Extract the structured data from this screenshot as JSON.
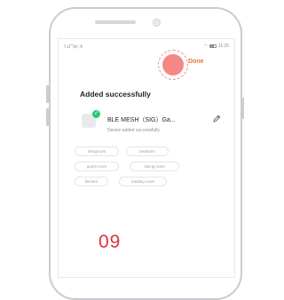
{
  "status_bar": {
    "left": "ﾅ⊿ℸ⊜↨⇞",
    "time": "11:35"
  },
  "action": {
    "done_label": "Done"
  },
  "page": {
    "title": "Added successfully"
  },
  "device": {
    "name": "BLE MESH（SIG）Ga...",
    "status": "Device added successfully"
  },
  "rooms": [
    [
      "livingroom",
      "bedroom"
    ],
    [
      "guest room",
      "dining room"
    ],
    [
      "kitchen",
      "reading room"
    ]
  ],
  "step_number": "09",
  "colors": {
    "accent": "#f2702e",
    "success": "#2bc87a",
    "tap_marker": "#f47a7a",
    "step": "#e0333a"
  }
}
